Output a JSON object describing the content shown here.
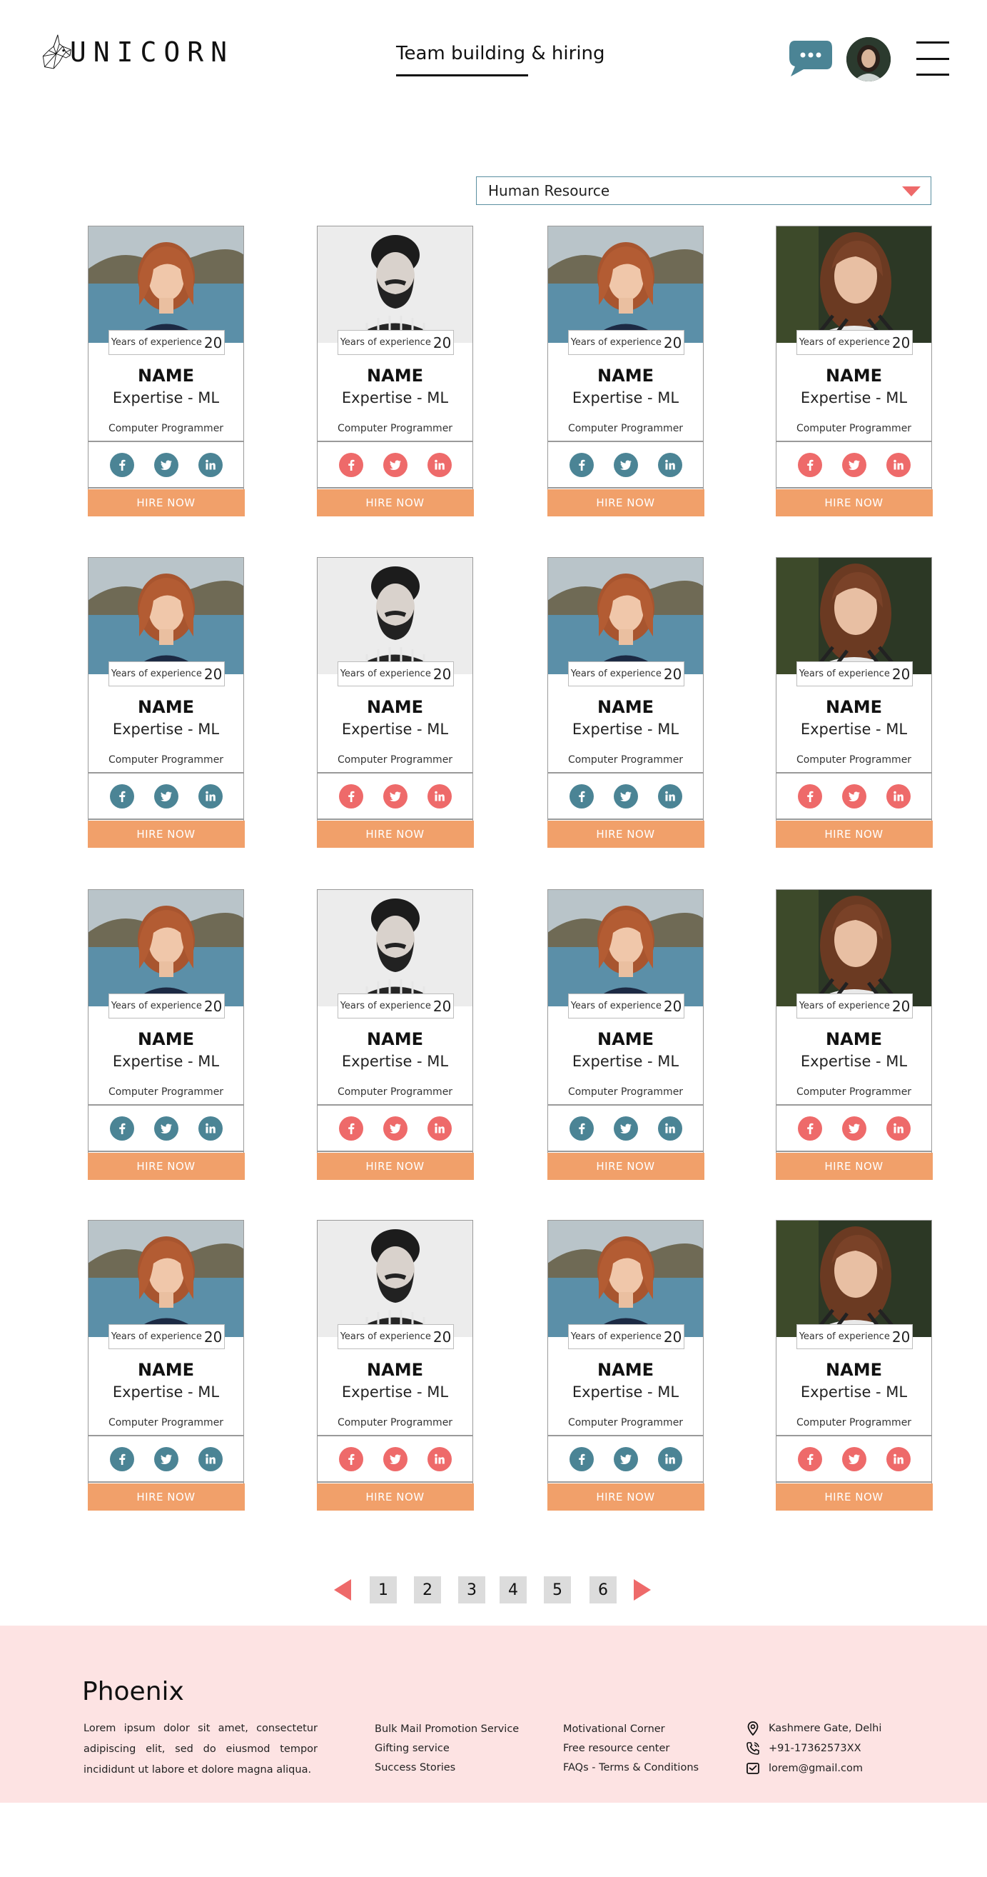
{
  "header": {
    "logo_text": "UNICORN",
    "nav_tab": "Team building & hiring"
  },
  "filter": {
    "selected": "Human Resource"
  },
  "card_template": {
    "experience_label": "Years of experience",
    "experience_value": "20",
    "name": "NAME",
    "expertise": "Expertise - ML",
    "role": "Computer Programmer",
    "hire_label": "HIRE NOW"
  },
  "cards": [
    {
      "photo": "woman-lake",
      "social_color": "#4b8495"
    },
    {
      "photo": "bearded-man",
      "social_color": "#ee6a6a"
    },
    {
      "photo": "woman-lake",
      "social_color": "#4b8495"
    },
    {
      "photo": "woman-dark",
      "social_color": "#ee6a6a"
    },
    {
      "photo": "woman-lake",
      "social_color": "#4b8495"
    },
    {
      "photo": "bearded-man",
      "social_color": "#ee6a6a"
    },
    {
      "photo": "woman-lake",
      "social_color": "#4b8495"
    },
    {
      "photo": "woman-dark",
      "social_color": "#ee6a6a"
    },
    {
      "photo": "woman-lake",
      "social_color": "#4b8495"
    },
    {
      "photo": "bearded-man",
      "social_color": "#ee6a6a"
    },
    {
      "photo": "woman-lake",
      "social_color": "#4b8495"
    },
    {
      "photo": "woman-dark",
      "social_color": "#ee6a6a"
    },
    {
      "photo": "woman-lake",
      "social_color": "#4b8495"
    },
    {
      "photo": "bearded-man",
      "social_color": "#ee6a6a"
    },
    {
      "photo": "woman-lake",
      "social_color": "#4b8495"
    },
    {
      "photo": "woman-dark",
      "social_color": "#ee6a6a"
    }
  ],
  "pagination": {
    "pages": [
      "1",
      "2",
      "3",
      "4",
      "5",
      "6"
    ]
  },
  "footer": {
    "brand": "Phoenix",
    "description": "Lorem ipsum dolor sit amet, consectetur adipiscing elit, sed do eiusmod tempor incididunt ut labore et dolore magna aliqua.",
    "links_col1": [
      "Bulk Mail Promotion Service",
      "Gifting service",
      "Success Stories"
    ],
    "links_col2": [
      "Motivational Corner",
      "Free resource center",
      "FAQs - Terms & Conditions"
    ],
    "contact": {
      "address": "Kashmere Gate, Delhi",
      "phone": "+91-17362573XX",
      "email": "lorem@gmail.com"
    }
  },
  "colors": {
    "accent_teal": "#4b8495",
    "accent_coral": "#ee6a6a",
    "hire_orange": "#f1a06a",
    "footer_bg": "#fde3e3"
  }
}
